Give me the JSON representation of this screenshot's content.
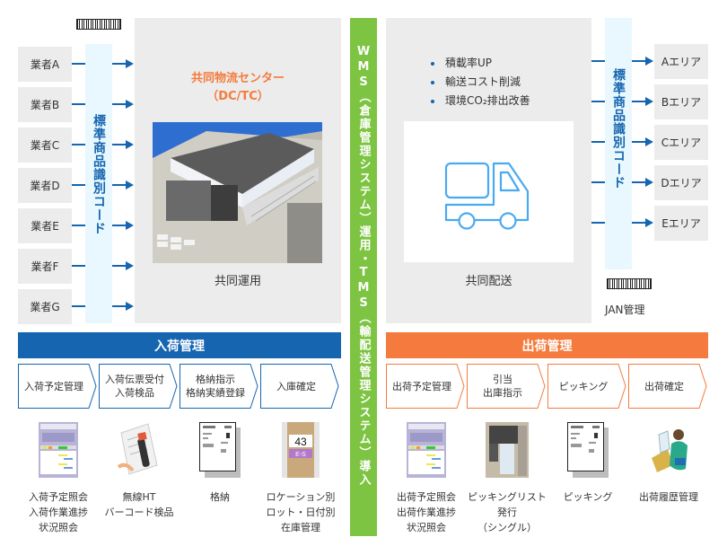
{
  "vendors": [
    "業者A",
    "業者B",
    "業者C",
    "業者D",
    "業者E",
    "業者F",
    "業者G"
  ],
  "code_band_label": "標準商品識別コード",
  "center": {
    "title_line1": "共同物流センター",
    "title_line2": "（DC/TC）",
    "caption": "共同運用",
    "title_color": "#f47b3d"
  },
  "wms_band_label": "WMS（倉庫管理システム）運用・TMS（輸配送管理システム）導入",
  "delivery": {
    "bullets": [
      "積載率UP",
      "輸送コスト削減",
      "環境CO₂排出改善"
    ],
    "caption": "共同配送"
  },
  "right_code_band_label": "標準商品識別コード",
  "areas": [
    "Aエリア",
    "Bエリア",
    "Cエリア",
    "Dエリア",
    "Eエリア"
  ],
  "jan_label": "JAN管理",
  "inbound": {
    "title": "入荷管理",
    "color": "#1565b0",
    "steps": [
      "入荷予定管理",
      "入荷伝票受付\n入荷検品",
      "格納指示\n格納実績登録",
      "入庫確定"
    ],
    "items": [
      {
        "icon": "screen-thumbnail",
        "caption": "入荷予定照会\n入荷作業進捗\n状況照会"
      },
      {
        "icon": "handheld-scanner",
        "caption": "無線HT\nバーコード検品"
      },
      {
        "icon": "document-sheet",
        "caption": "格納"
      },
      {
        "icon": "location-label",
        "caption": "ロケーション別\nロット・日付別\n在庫管理"
      }
    ]
  },
  "outbound": {
    "title": "出荷管理",
    "color": "#f47b3d",
    "steps": [
      "出荷予定管理",
      "引当\n出庫指示",
      "ピッキング",
      "出荷確定"
    ],
    "items": [
      {
        "icon": "screen-thumbnail",
        "caption": "出荷予定照会\n出荷作業進捗\n状況照会"
      },
      {
        "icon": "label-printer",
        "caption": "ピッキングリスト\n発行\n（シングル）"
      },
      {
        "icon": "document-sheet",
        "caption": "ピッキング"
      },
      {
        "icon": "office-worker",
        "caption": "出荷履歴管理"
      }
    ]
  }
}
